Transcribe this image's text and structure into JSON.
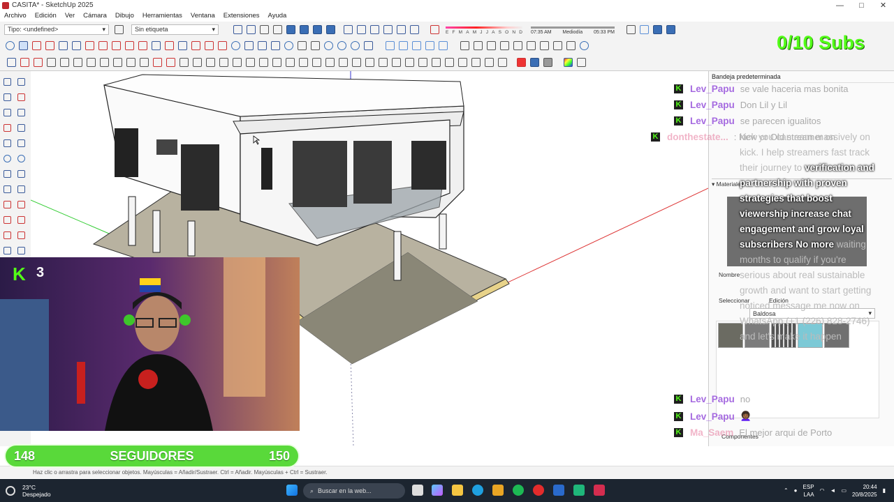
{
  "window": {
    "title": "CASITA* - SketchUp 2025",
    "min": "—",
    "max": "□",
    "close": "✕"
  },
  "menu": [
    "Archivo",
    "Edición",
    "Ver",
    "Cámara",
    "Dibujo",
    "Herramientas",
    "Ventana",
    "Extensiones",
    "Ayuda"
  ],
  "toolbar": {
    "type_dropdown": "Tipo: <undefined>",
    "tag_dropdown": "Sin etiqueta",
    "shadow_months": [
      "E",
      "F",
      "M",
      "A",
      "M",
      "J",
      "J",
      "A",
      "S",
      "O",
      "N",
      "D"
    ],
    "time_start": "07:35 AM",
    "time_mid": "Mediodía",
    "time_end": "05:33 PM"
  },
  "overlay": {
    "subs": "0/10 Subs",
    "cam_badge": "K",
    "cam_number": "3"
  },
  "tray": {
    "title": "Bandeja predeterminada",
    "materials_header": "Materiales",
    "name_label": "Nombre",
    "tab_select": "Seleccionar",
    "tab_edit": "Edición",
    "library": "Baldosa",
    "components_header": "Componentes"
  },
  "chat": [
    {
      "user": "Lev_Papu",
      "msg": "se vale haceria mas bonita"
    },
    {
      "user": "Lev_Papu",
      "msg": "Don Lil y Lil"
    },
    {
      "user": "Lev_Papu",
      "msg": "se parecen igualitos"
    },
    {
      "user": "donthestate...",
      "msg": ": New or Old streamer on"
    }
  ],
  "spam": {
    "dim1": "kick you can earn massively on kick. I help streamers fast track their journey to",
    "bold": "verification and partnership with proven strategies that boost viewership increase chat engagement and grow loyal subscribers No more",
    "dim2": "waiting months to qualify if you're serious about real sustainable growth and want to start getting noticed message me now on WhatsApp (+1 (226) 828-2746) and let's make it happen"
  },
  "chat_bottom": [
    {
      "user": "Lev_Papu",
      "msg": "no"
    },
    {
      "user": "Lev_Papu",
      "msg": "👩🏾‍🦱"
    },
    {
      "user": "Ma_Saem",
      "msg": "El mejor arqui de Porto"
    }
  ],
  "followers": {
    "current": "148",
    "label": "SEGUIDORES",
    "goal": "150"
  },
  "status": {
    "hint": "Haz clic o arrastra para seleccionar objetos. Mayúsculas = Añadir/Sustraer. Ctrl = Añadir. Mayúsculas + Ctrl = Sustraer."
  },
  "taskbar": {
    "temp": "23°C",
    "weather": "Despejado",
    "search": "Buscar en la web...",
    "lang1": "ESP",
    "lang2": "LAA",
    "time": "20:44",
    "date": "20/8/2025"
  }
}
